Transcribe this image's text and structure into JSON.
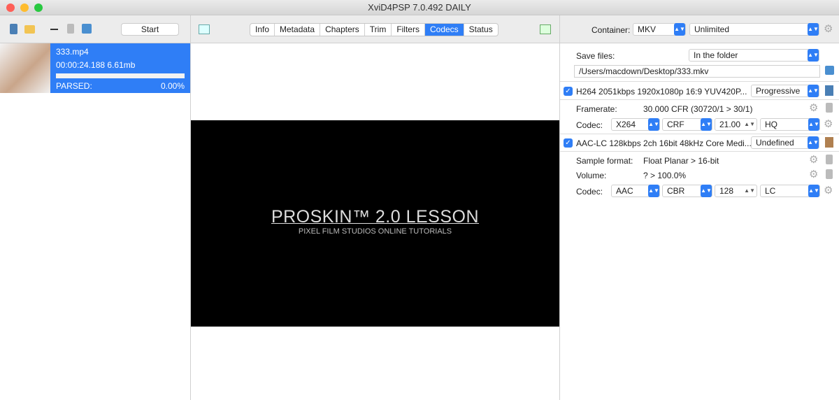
{
  "window": {
    "title": "XviD4PSP 7.0.492 DAILY"
  },
  "toolbar": {
    "start_label": "Start"
  },
  "tabs": [
    "Info",
    "Metadata",
    "Chapters",
    "Trim",
    "Filters",
    "Codecs",
    "Status"
  ],
  "selected_tab": "Codecs",
  "queue": [
    {
      "name": "333.mp4",
      "info": "00:00:24.188 6.61mb",
      "status": "PARSED:",
      "percent": "0.00%",
      "progress": 0
    }
  ],
  "preview": {
    "title": "PROSKIN™ 2.0 LESSON",
    "subtitle": "PIXEL FILM STUDIOS ONLINE TUTORIALS"
  },
  "right": {
    "container_label": "Container:",
    "container": "MKV",
    "size_limit": "Unlimited",
    "save_files_label": "Save files:",
    "save_files": "In the folder",
    "path": "/Users/macdown/Desktop/333.mkv",
    "video": {
      "summary": "H264 2051kbps 1920x1080p 16:9 YUV420P...",
      "scan": "Progressive",
      "framerate_label": "Framerate:",
      "framerate": "30.000 CFR (30720/1 > 30/1)",
      "codec_label": "Codec:",
      "codec": "X264",
      "mode": "CRF",
      "value": "21.00",
      "preset": "HQ"
    },
    "audio": {
      "summary": "AAC-LC 128kbps 2ch 16bit 48kHz Core Medi...",
      "lang": "Undefined",
      "sample_label": "Sample format:",
      "sample": "Float Planar > 16-bit",
      "volume_label": "Volume:",
      "volume": "? > 100.0%",
      "codec_label": "Codec:",
      "codec": "AAC",
      "mode": "CBR",
      "value": "128",
      "profile": "LC"
    }
  },
  "colors": {
    "accent": "#2f7ef6"
  }
}
